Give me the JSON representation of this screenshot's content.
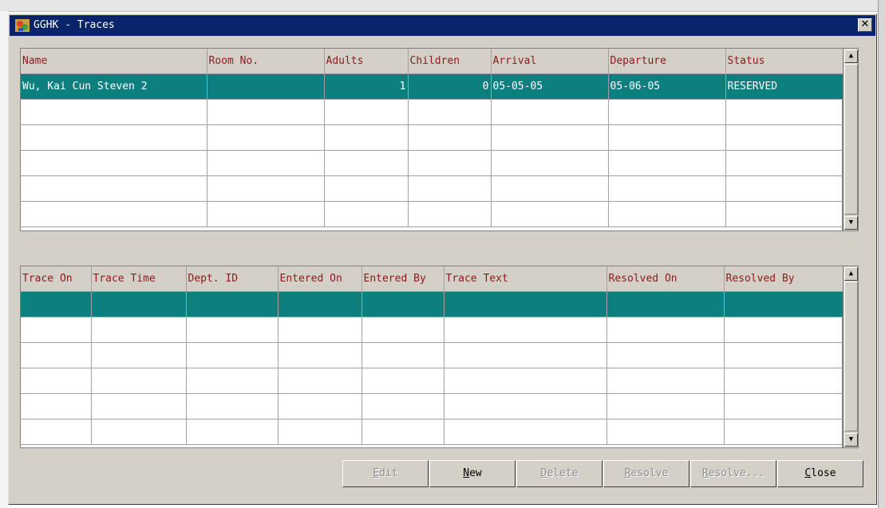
{
  "window": {
    "title": "GGHK - Traces",
    "close_glyph": "✕"
  },
  "reservations": {
    "columns": [
      "Name",
      "Room No.",
      "Adults",
      "Children",
      "Arrival",
      "Departure",
      "Status"
    ],
    "rows": [
      {
        "name": "Wu, Kai Cun Steven 2",
        "room": "",
        "adults": "1",
        "children": "0",
        "arrival": "05-05-05",
        "departure": "05-06-05",
        "status": "RESERVED"
      }
    ],
    "empty_rows": 5
  },
  "traces": {
    "columns": [
      "Trace On",
      "Trace Time",
      "Dept. ID",
      "Entered On",
      "Entered By",
      "Trace Text",
      "Resolved On",
      "Resolved By"
    ],
    "rows": [],
    "empty_rows": 6
  },
  "buttons": {
    "edit": {
      "label": "Edit",
      "enabled": false
    },
    "new": {
      "label": "New",
      "enabled": true
    },
    "delete": {
      "label": "Delete",
      "enabled": false
    },
    "resolve": {
      "label": "Resolve",
      "enabled": false
    },
    "resolve_more": {
      "label": "Resolve...",
      "enabled": false
    },
    "close": {
      "label": "Close",
      "enabled": true
    }
  },
  "colors": {
    "titlebar": "#0a246a",
    "selection": "#0e7f7f",
    "header_text": "#8b1a1a"
  }
}
